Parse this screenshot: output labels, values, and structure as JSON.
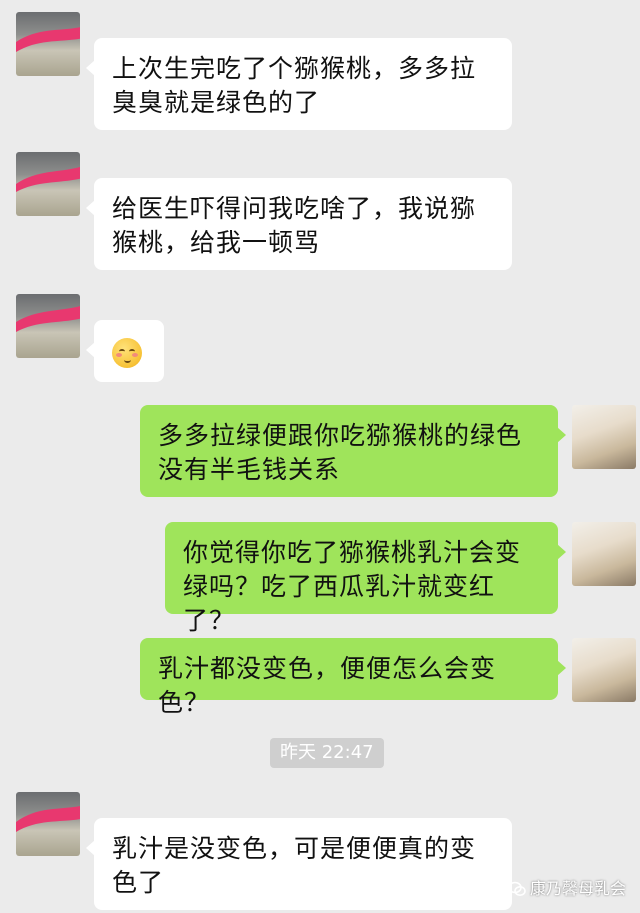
{
  "messages": [
    {
      "side": "in",
      "text": "上次生完吃了个猕猴桃，多多拉臭臭就是绿色的了"
    },
    {
      "side": "in",
      "text": "给医生吓得问我吃啥了，我说猕猴桃，给我一顿骂"
    },
    {
      "side": "in",
      "emoji": "smiling-face-with-blush"
    },
    {
      "side": "out",
      "text": "多多拉绿便跟你吃猕猴桃的绿色没有半毛钱关系"
    },
    {
      "side": "out",
      "text": "你觉得你吃了猕猴桃乳汁会变绿吗？吃了西瓜乳汁就变红了？"
    },
    {
      "side": "out",
      "text": "乳汁都没变色，便便怎么会变色？"
    },
    {
      "side": "in",
      "text": "乳汁是没变色，可是便便真的变色了"
    }
  ],
  "timestamp": "昨天 22:47",
  "watermark": "康乃馨母乳会",
  "colors": {
    "background": "#ebebeb",
    "incoming_bubble": "#ffffff",
    "outgoing_bubble": "#9fe45b",
    "redaction_scarf": "#e8386f"
  },
  "icons": {
    "watermark": "wechat-icon",
    "emoji": "smiling-face-with-blush"
  }
}
